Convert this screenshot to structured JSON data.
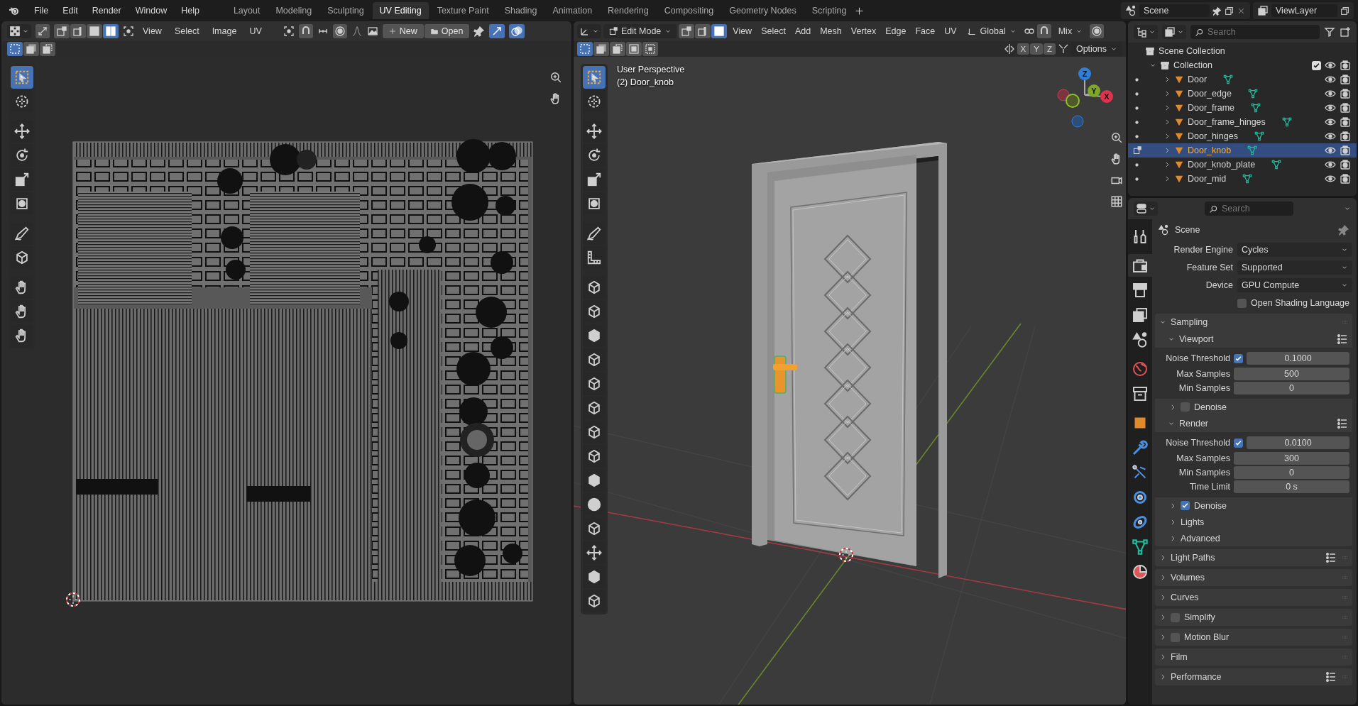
{
  "menu": [
    "File",
    "Edit",
    "Render",
    "Window",
    "Help"
  ],
  "workspaces": [
    {
      "label": "Layout",
      "selected": false
    },
    {
      "label": "Modeling",
      "selected": false
    },
    {
      "label": "Sculpting",
      "selected": false
    },
    {
      "label": "UV Editing",
      "selected": true
    },
    {
      "label": "Texture Paint",
      "selected": false
    },
    {
      "label": "Shading",
      "selected": false
    },
    {
      "label": "Animation",
      "selected": false
    },
    {
      "label": "Rendering",
      "selected": false
    },
    {
      "label": "Compositing",
      "selected": false
    },
    {
      "label": "Geometry Nodes",
      "selected": false
    },
    {
      "label": "Scripting",
      "selected": false
    }
  ],
  "scene": "Scene",
  "view_layer": "ViewLayer",
  "uv_editor": {
    "select_modes": [
      {
        "selected": false
      },
      {
        "selected": false
      },
      {
        "selected": false
      },
      {
        "selected": true
      }
    ],
    "menus": [
      "View",
      "Select",
      "Image",
      "UV"
    ],
    "new_button": "New",
    "open_button": "Open",
    "box_modes": [
      {
        "selected": true
      },
      {
        "selected": false
      },
      {
        "selected": false
      }
    ]
  },
  "viewport": {
    "mode": "Edit Mode",
    "select_modes": [
      {
        "selected": false
      },
      {
        "selected": false
      },
      {
        "selected": true
      }
    ],
    "menus": [
      "View",
      "Select",
      "Add",
      "Mesh",
      "Vertex",
      "Edge",
      "Face",
      "UV"
    ],
    "orientation": "Global",
    "falloff": "Mix",
    "box_modes": [
      {
        "selected": true
      },
      {
        "selected": false
      },
      {
        "selected": false
      },
      {
        "selected": false
      },
      {
        "selected": false
      }
    ],
    "axes": [
      "X",
      "Y",
      "Z"
    ],
    "options": "Options",
    "overlay_lines": [
      "User Perspective",
      "(2) Door_knob"
    ],
    "gizmo": [
      {
        "label": "Z",
        "color": "#2f7fd8"
      },
      {
        "label": "Y",
        "color": "#7fa52a"
      },
      {
        "label": "X",
        "color": "#e0344c"
      }
    ]
  },
  "outliner": {
    "search_placeholder": "Search",
    "scene_collection": "Scene Collection",
    "collection": {
      "name": "Collection",
      "checked": true,
      "expanded": true
    },
    "objects": [
      {
        "name": "Door",
        "selected": false
      },
      {
        "name": "Door_edge",
        "selected": false
      },
      {
        "name": "Door_frame",
        "selected": false
      },
      {
        "name": "Door_frame_hinges",
        "selected": false
      },
      {
        "name": "Door_hinges",
        "selected": false
      },
      {
        "name": "Door_knob",
        "selected": true
      },
      {
        "name": "Door_knob_plate",
        "selected": false
      },
      {
        "name": "Door_mid",
        "selected": false
      }
    ]
  },
  "properties": {
    "search_placeholder": "Search",
    "tabs": [
      {
        "selected": false
      },
      {
        "selected": true
      },
      {
        "selected": false
      },
      {
        "selected": false
      },
      {
        "selected": false
      },
      {
        "selected": false
      },
      {
        "selected": false
      },
      {
        "selected": false
      },
      {
        "selected": false
      },
      {
        "selected": false
      },
      {
        "selected": false
      },
      {
        "selected": false
      },
      {
        "selected": false
      },
      {
        "selected": false
      }
    ],
    "context": "Scene",
    "fields": [
      {
        "kind": "dropdown",
        "label": "Render Engine",
        "value": "Cycles"
      },
      {
        "kind": "dropdown",
        "label": "Feature Set",
        "value": "Supported"
      },
      {
        "kind": "dropdown",
        "label": "Device",
        "value": "GPU Compute"
      },
      {
        "kind": "checkbox",
        "label": "Open Shading Language",
        "checked": false
      }
    ],
    "sampling": {
      "title": "Sampling",
      "expanded": true,
      "subpanels": [
        {
          "title": "Viewport",
          "expanded": true,
          "rows": [
            {
              "kind": "toggle-number",
              "label": "Noise Threshold",
              "checked": true,
              "value": "0.1000"
            },
            {
              "kind": "number",
              "label": "Max Samples",
              "value": "500"
            },
            {
              "kind": "number",
              "label": "Min Samples",
              "value": "0"
            }
          ],
          "children": [
            {
              "title": "Denoise",
              "checked": false,
              "expanded": false
            }
          ]
        },
        {
          "title": "Render",
          "expanded": true,
          "rows": [
            {
              "kind": "toggle-number",
              "label": "Noise Threshold",
              "checked": true,
              "value": "0.0100"
            },
            {
              "kind": "number",
              "label": "Max Samples",
              "value": "300"
            },
            {
              "kind": "number",
              "label": "Min Samples",
              "value": "0"
            },
            {
              "kind": "number",
              "label": "Time Limit",
              "value": "0 s"
            }
          ],
          "children": [
            {
              "title": "Denoise",
              "checked": true,
              "expanded": false
            },
            {
              "title": "Lights",
              "expanded": false
            },
            {
              "title": "Advanced",
              "expanded": false
            }
          ]
        }
      ]
    },
    "panels": [
      {
        "title": "Light Paths",
        "expanded": false,
        "presets": true
      },
      {
        "title": "Volumes",
        "expanded": false,
        "presets": false
      },
      {
        "title": "Curves",
        "expanded": false,
        "presets": false
      },
      {
        "title": "Simplify",
        "expanded": false,
        "presets": false,
        "checked": false
      },
      {
        "title": "Motion Blur",
        "expanded": false,
        "presets": false,
        "checked": false
      },
      {
        "title": "Film",
        "expanded": false,
        "presets": false
      },
      {
        "title": "Performance",
        "expanded": false,
        "presets": true
      }
    ]
  }
}
